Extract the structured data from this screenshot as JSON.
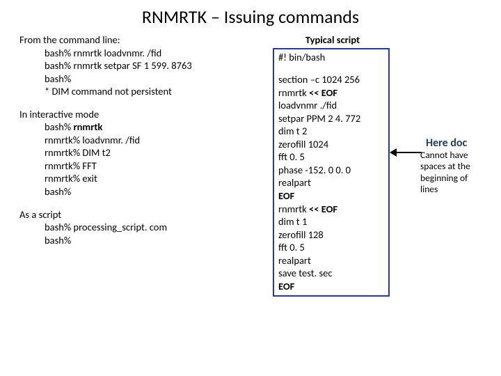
{
  "title": "RNMRTK –  Issuing commands",
  "left": {
    "cmd_head": "From the command line:",
    "cmd_lines": [
      "bash% rnmrtk loadvnmr. /fid",
      "bash% rnmrtk setpar SF 1 599. 8763",
      "bash%",
      "* DIM command not persistent"
    ],
    "int_head": "In interactive mode",
    "int_lines": [
      {
        "pre": "bash% ",
        "bold": "rnmrtk"
      },
      {
        "pre": "rnmrtk% ",
        "rest": "loadvnmr. /fid"
      },
      {
        "pre": "rnmrtk% ",
        "rest": "DIM t2"
      },
      {
        "pre": "rnmrtk% ",
        "rest": "FFT"
      },
      {
        "pre": "rnmrtk% ",
        "rest": "exit"
      },
      {
        "pre": "bash%"
      }
    ],
    "scr_head": "As a script",
    "scr_lines": [
      "bash% processing_script. com",
      "bash%"
    ]
  },
  "right": {
    "title": "Typical script",
    "shebang": "#! bin/bash",
    "body": [
      {
        "t": "section –c 1024 256"
      },
      {
        "pre": "rnmrtk ",
        "bold": "<< EOF"
      },
      {
        "t": "loadvnmr ./fid"
      },
      {
        "t": "setpar PPM 2 4. 772"
      },
      {
        "t": "dim t 2"
      },
      {
        "t": "zerofill 1024"
      },
      {
        "t": "fft 0. 5"
      },
      {
        "t": "phase -152. 0 0. 0"
      },
      {
        "t": "realpart"
      },
      {
        "bold": "EOF"
      },
      {
        "pre": "rnmrtk ",
        "bold": "<< EOF"
      },
      {
        "t": "dim t 1"
      },
      {
        "t": "zerofill 128"
      },
      {
        "t": "fft 0. 5"
      },
      {
        "t": "realpart"
      },
      {
        "t": "save test. sec"
      },
      {
        "bold": "EOF"
      }
    ]
  },
  "annot": {
    "title": "Here doc",
    "l1": "Cannot have",
    "l2": "spaces at the",
    "l3": "beginning of",
    "l4": "lines"
  }
}
